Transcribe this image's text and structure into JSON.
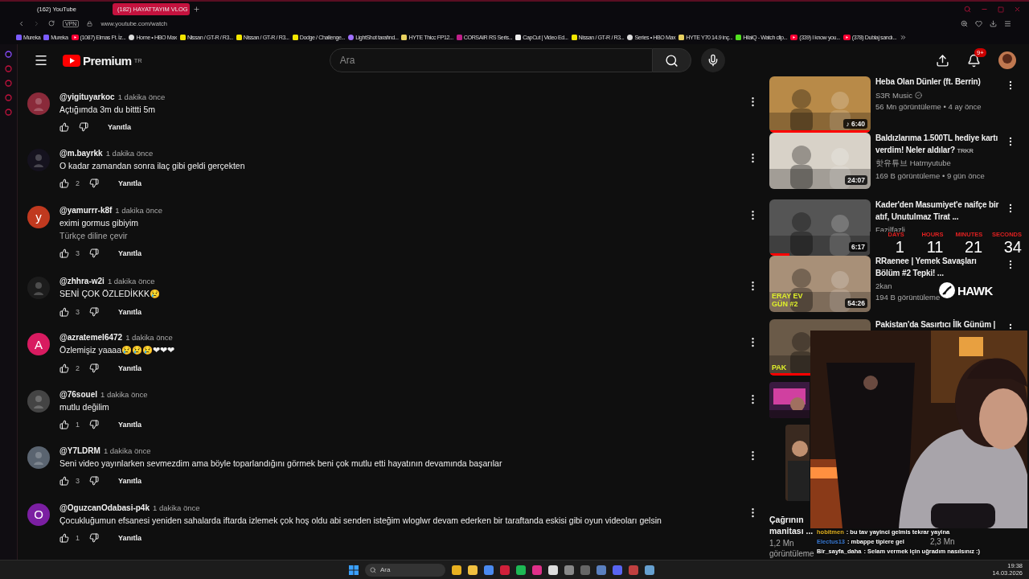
{
  "browser": {
    "tabs": [
      {
        "label": "(162) YouTube",
        "selected": false
      },
      {
        "label": "(182) HAYATTAYIM VLOG",
        "selected": true
      }
    ],
    "address": "www.youtube.com/watch",
    "vpn": "VPN",
    "bookmarks": [
      {
        "label": "Mureka",
        "kind": "square",
        "color": "#7b5cff"
      },
      {
        "label": "Mureka",
        "kind": "square",
        "color": "#7b5cff"
      },
      {
        "label": "(1087) Elmas Ft. İz...",
        "kind": "play",
        "color": "#ff0033"
      },
      {
        "label": "Home • HBO Max",
        "kind": "circle",
        "color": "#dddddd"
      },
      {
        "label": "Nissan / GT-R / R3...",
        "kind": "square",
        "color": "#f2e600"
      },
      {
        "label": "Nissan / GT-R / R3...",
        "kind": "square",
        "color": "#f2e600"
      },
      {
        "label": "Dodge / Challenge...",
        "kind": "square",
        "color": "#f2e600"
      },
      {
        "label": "LightShot tarafınd...",
        "kind": "circle",
        "color": "#a070ff"
      },
      {
        "label": "HYTE Thicc FP12...",
        "kind": "square",
        "color": "#e8d060"
      },
      {
        "label": "CORSAIR RS Seris...",
        "kind": "square",
        "color": "#c0208a"
      },
      {
        "label": "CapCut | Video Ed...",
        "kind": "square",
        "color": "#eeeeee"
      },
      {
        "label": "Nissan / GT-R / R3...",
        "kind": "square",
        "color": "#f2e600"
      },
      {
        "label": "Series • HBO Max",
        "kind": "circle",
        "color": "#dddddd"
      },
      {
        "label": "HYTE Y70 14.9 inç...",
        "kind": "square",
        "color": "#e8d060"
      },
      {
        "label": "HilalQ - Watch clip...",
        "kind": "square",
        "color": "#52e020"
      },
      {
        "label": "(339) I know you...",
        "kind": "play",
        "color": "#ff0033"
      },
      {
        "label": "(378) Dublaj sandı...",
        "kind": "play",
        "color": "#ff0033"
      }
    ]
  },
  "youtube": {
    "logo": "Premium",
    "region": "TR",
    "search": {
      "placeholder": "Ara"
    },
    "notifications": "9+",
    "comments": [
      {
        "handle": "@yigituyarkoc",
        "time": "1 dakika önce",
        "text": "Açtığımda 3m du bittti 5m",
        "reply": "Yanıtla"
      },
      {
        "handle": "@m.bayrkk",
        "time": "1 dakika önce",
        "text": "O kadar zamandan sonra ilaç gibi geldi gerçekten",
        "likes": "2",
        "reply": "Yanıtla"
      },
      {
        "handle": "@yamurrr-k8f",
        "time": "1 dakika önce",
        "text": "eximi gormus gibiyim",
        "translate": "Türkçe diline çevir",
        "avatar": {
          "kind": "letter",
          "letter": "y",
          "color": "#c0391f"
        },
        "likes": "3",
        "reply": "Yanıtla"
      },
      {
        "handle": "@zhhra-w2i",
        "time": "1 dakika önce",
        "text": "SENİ ÇOK ÖZLEDİKKK😢",
        "likes": "3",
        "reply": "Yanıtla"
      },
      {
        "handle": "@azratemel6472",
        "time": "1 dakika önce",
        "text": "Özlemişiz yaaaa😢😢😢❤❤❤",
        "avatar": {
          "kind": "letter",
          "letter": "A",
          "color": "#d81b60"
        },
        "likes": "2",
        "reply": "Yanıtla"
      },
      {
        "handle": "@76souel",
        "time": "1 dakika önce",
        "text": "mutlu değilim",
        "likes": "1",
        "reply": "Yanıtla"
      },
      {
        "handle": "@Y7LDRM",
        "time": "1 dakika önce",
        "text": "Seni video yayınlarken sevmezdim ama böyle toparlandığını görmek beni çok mutlu etti hayatının devamında başarılar",
        "likes": "3",
        "reply": "Yanıtla"
      },
      {
        "handle": "@OguzcanOdabasi-p4k",
        "time": "1 dakika önce",
        "text": "Çocukluğumun efsanesi yeniden sahalarda iftarda izlemek çok hoş oldu abi senden isteğim wloglwr devam ederken bir taraftanda eskisi gibi oyun videoları gelsin",
        "avatar": {
          "kind": "letter",
          "letter": "O",
          "color": "#7b1fa2"
        },
        "likes": "1",
        "reply": "Yanıtla"
      }
    ],
    "videos": [
      {
        "title": "Heba Olan Dünler (ft. Berrin)",
        "channel": "S3R Music",
        "verified": true,
        "meta": "56 Mn görüntüleme • 4 ay önce",
        "duration": "♪ 6:40"
      },
      {
        "title": "Baldızlarıma 1.500TL hediye kartı verdim! Neler aldılar?",
        "tag": "TRKR",
        "channel": "핫유튜브 Hatmyutube",
        "meta": "169 B görüntüleme • 9 gün önce",
        "duration": "24:07"
      },
      {
        "title": "Kader'den Masumiyet'e naifçe bir atıf, Unutulmaz Tirat ...",
        "channel": "Fazilfazli",
        "duration": "6:17"
      },
      {
        "title": "RRaenee | Yemek Savaşları Bölüm #2 Tepki! ...",
        "channel": "2kan",
        "meta": "194 B görüntüleme",
        "duration": "54:26",
        "caption": "ERAY EV GÜN #2"
      },
      {
        "title": "Pakistan'da Sasırtıcı İlk Günüm |",
        "caption": "PAK"
      }
    ],
    "shorts": [
      {
        "title": "Çağrının manitası ...",
        "views": "1,2 Mn",
        "unit": "görüntüleme"
      },
      {
        "views": "2,3 Mn"
      }
    ]
  },
  "overlay": {
    "countdown": [
      {
        "label": "DAYS",
        "value": "1"
      },
      {
        "label": "HOURS",
        "value": "11"
      },
      {
        "label": "MINUTES",
        "value": "21"
      },
      {
        "label": "SECONDS",
        "value": "34"
      }
    ],
    "logo": "HAWK",
    "chat": [
      {
        "user": "hobitmen",
        "color": "#e0b020",
        "message": ": bu tav yayinci gelmis tekrar yayina"
      },
      {
        "user": "Electus13",
        "color": "#3a7bd5",
        "message": ": mbappe tiplere gel"
      },
      {
        "user": "Bir_sayfa_daha",
        "color": "#ffffff",
        "message": ": Selam vermek için uğradım nasılsınız :)"
      }
    ]
  },
  "taskbar": {
    "search": "Ara",
    "time": "19:38",
    "date": "14.03.2026"
  }
}
